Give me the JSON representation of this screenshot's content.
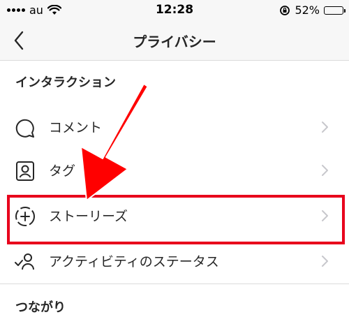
{
  "status_bar": {
    "carrier": "au",
    "time": "12:28",
    "battery": "52%",
    "battery_level": 0.52,
    "icons": [
      "signal-icon",
      "wifi-icon",
      "rotation-lock-icon",
      "battery-icon"
    ]
  },
  "nav": {
    "title": "プライバシー",
    "back_icon": "chevron-left-icon"
  },
  "sections": {
    "interaction": {
      "title": "インタラクション",
      "items": [
        {
          "label": "コメント",
          "icon": "comment-icon"
        },
        {
          "label": "タグ",
          "icon": "tag-person-icon"
        },
        {
          "label": "ストーリーズ",
          "icon": "story-add-icon"
        },
        {
          "label": "アクティビティのステータス",
          "icon": "activity-status-icon"
        }
      ]
    },
    "connections": {
      "title": "つながり"
    }
  },
  "annotation": {
    "highlight_color": "#e8001c",
    "arrow_color": "#ff0000",
    "highlighted_item": "ストーリーズ"
  }
}
